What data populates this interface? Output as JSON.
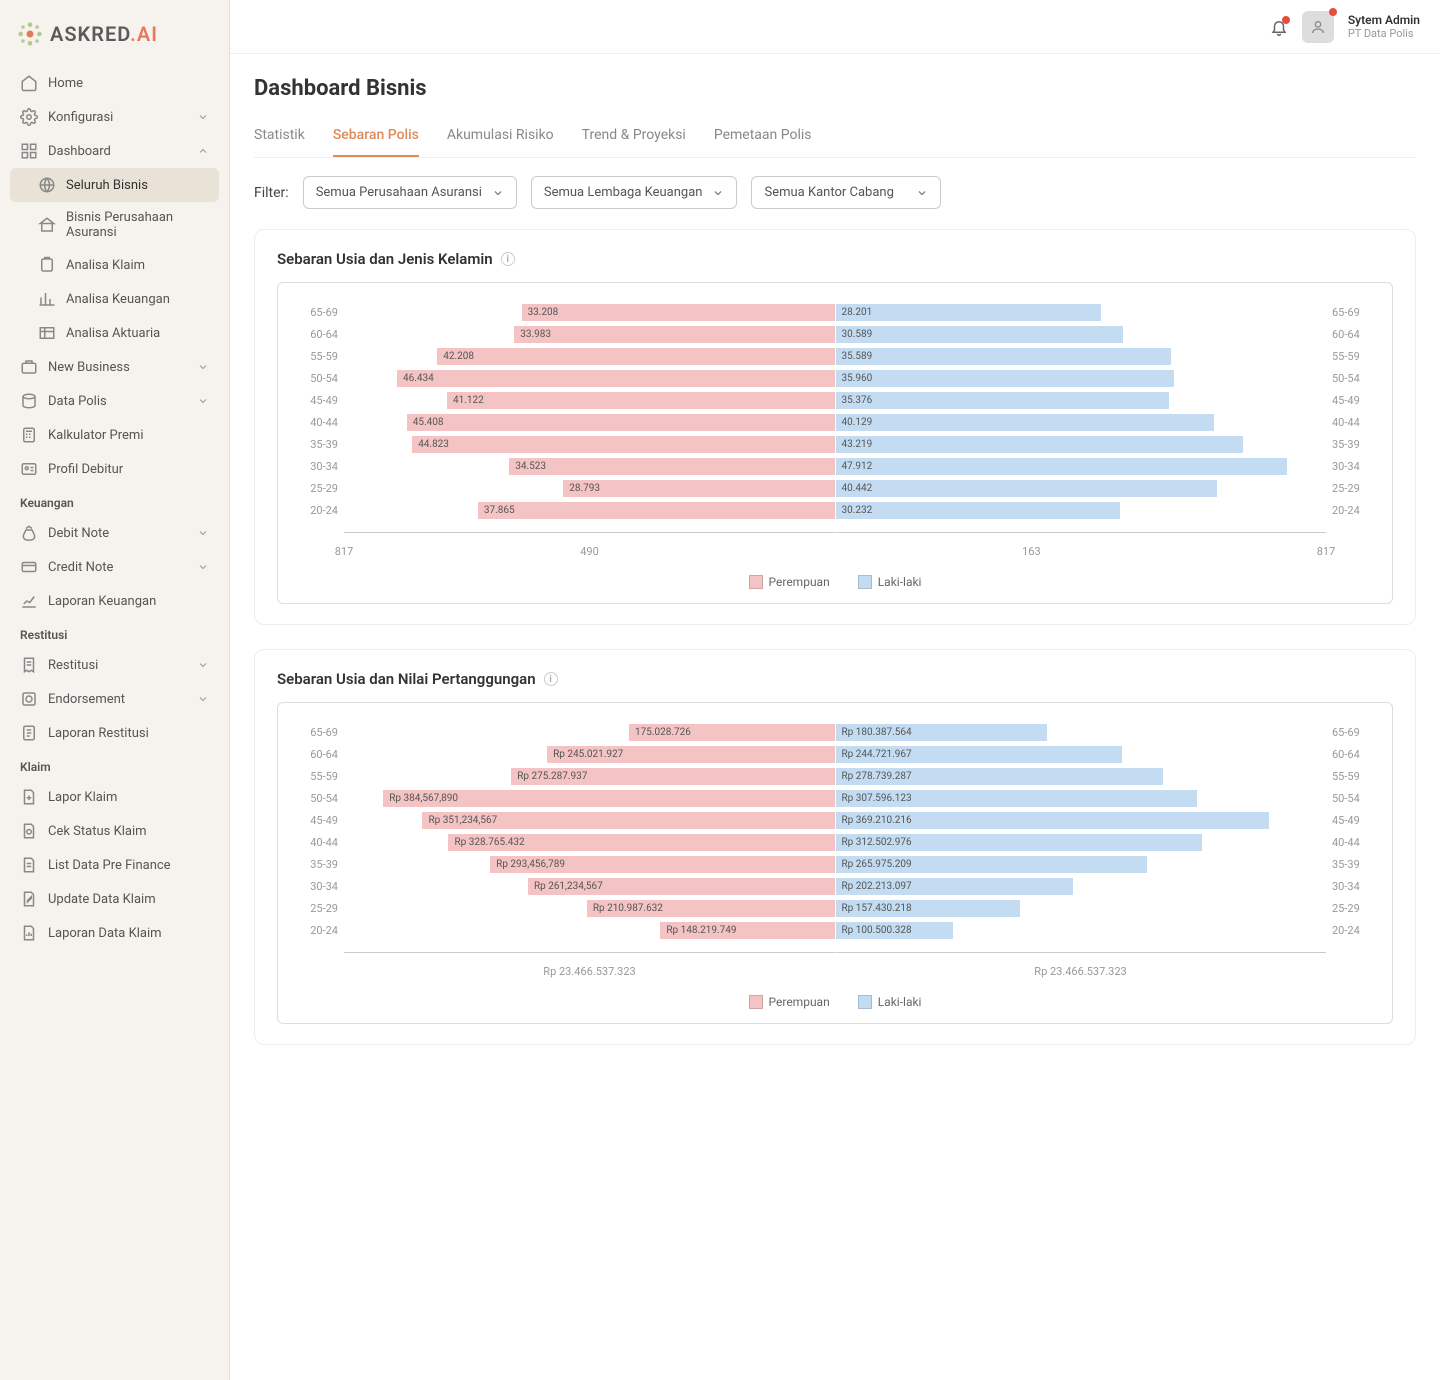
{
  "brand": {
    "text_a": "ASKRED",
    "text_b": ".AI"
  },
  "header": {
    "user_name": "Sytem Admin",
    "user_org": "PT Data Polis"
  },
  "nav": {
    "home": "Home",
    "konfigurasi": "Konfigurasi",
    "dashboard": "Dashboard",
    "seluruh_bisnis": "Seluruh Bisnis",
    "bisnis_perusahaan": "Bisnis Perusahaan Asuransi",
    "analisa_klaim": "Analisa Klaim",
    "analisa_keuangan": "Analisa Keuangan",
    "analisa_aktuaria": "Analisa Aktuaria",
    "new_business": "New Business",
    "data_polis": "Data Polis",
    "kalkulator_premi": "Kalkulator Premi",
    "profil_debitur": "Profil Debitur",
    "section_keuangan": "Keuangan",
    "debit_note": "Debit Note",
    "credit_note": "Credit Note",
    "laporan_keuangan": "Laporan Keuangan",
    "section_restitusi": "Restitusi",
    "restitusi": "Restitusi",
    "endorsement": "Endorsement",
    "laporan_restitusi": "Laporan Restitusi",
    "section_klaim": "Klaim",
    "lapor_klaim": "Lapor Klaim",
    "cek_status_klaim": "Cek Status Klaim",
    "list_data_pre_finance": "List Data Pre Finance",
    "update_data_klaim": "Update Data Klaim",
    "laporan_data_klaim": "Laporan Data Klaim"
  },
  "page": {
    "title": "Dashboard Bisnis",
    "tabs": [
      "Statistik",
      "Sebaran Polis",
      "Akumulasi Risiko",
      "Trend & Proyeksi",
      "Pemetaan Polis"
    ],
    "filter_label": "Filter:",
    "filters": [
      "Semua Perusahaan Asuransi",
      "Semua Lembaga Keuangan",
      "Semua Kantor Cabang"
    ]
  },
  "chart1": {
    "title": "Sebaran Usia dan Jenis Kelamin",
    "legend_fem": "Perempuan",
    "legend_male": "Laki-laki",
    "axis_left": [
      "817",
      "490"
    ],
    "axis_right": [
      "163",
      "817"
    ],
    "rows": [
      {
        "age": "65-69",
        "fem": "33.208",
        "male": "28.201"
      },
      {
        "age": "60-64",
        "fem": "33.983",
        "male": "30.589"
      },
      {
        "age": "55-59",
        "fem": "42.208",
        "male": "35.589"
      },
      {
        "age": "50-54",
        "fem": "46.434",
        "male": "35.960"
      },
      {
        "age": "45-49",
        "fem": "41.122",
        "male": "35.376"
      },
      {
        "age": "40-44",
        "fem": "45.408",
        "male": "40.129"
      },
      {
        "age": "35-39",
        "fem": "44.823",
        "male": "43.219"
      },
      {
        "age": "30-34",
        "fem": "34.523",
        "male": "47.912"
      },
      {
        "age": "25-29",
        "fem": "28.793",
        "male": "40.442"
      },
      {
        "age": "20-24",
        "fem": "37.865",
        "male": "30.232"
      }
    ]
  },
  "chart2": {
    "title": "Sebaran Usia dan Nilai Pertanggungan",
    "legend_fem": "Perempuan",
    "legend_male": "Laki-laki",
    "axis_left": "Rp 23.466.537.323",
    "axis_right": "Rp 23.466.537.323",
    "rows": [
      {
        "age": "65-69",
        "fem": "175.028.726",
        "male": "Rp 180.387.564"
      },
      {
        "age": "60-64",
        "fem": "Rp 245.021.927",
        "male": "Rp 244.721.967"
      },
      {
        "age": "55-59",
        "fem": "Rp 275.287.937",
        "male": "Rp 278.739.287"
      },
      {
        "age": "50-54",
        "fem": "Rp 384,567,890",
        "male": "Rp 307.596.123"
      },
      {
        "age": "45-49",
        "fem": "Rp 351,234,567",
        "male": "Rp 369.210.216"
      },
      {
        "age": "40-44",
        "fem": "Rp 328.765.432",
        "male": "Rp 312.502.976"
      },
      {
        "age": "35-39",
        "fem": "Rp 293,456,789",
        "male": "Rp 265.975.209"
      },
      {
        "age": "30-34",
        "fem": "Rp 261,234,567",
        "male": "Rp 202.213.097"
      },
      {
        "age": "25-29",
        "fem": "Rp 210.987.632",
        "male": "Rp 157.430.218"
      },
      {
        "age": "20-24",
        "fem": "Rp 148.219.749",
        "male": "Rp 100.500.328"
      }
    ]
  },
  "chart_data": [
    {
      "type": "bar",
      "title": "Sebaran Usia dan Jenis Kelamin",
      "orientation": "population-pyramid",
      "categories": [
        "65-69",
        "60-64",
        "55-59",
        "50-54",
        "45-49",
        "40-44",
        "35-39",
        "30-34",
        "25-29",
        "20-24"
      ],
      "series": [
        {
          "name": "Perempuan",
          "values": [
            33208,
            33983,
            42208,
            46434,
            41122,
            45408,
            44823,
            34523,
            28793,
            37865
          ]
        },
        {
          "name": "Laki-laki",
          "values": [
            28201,
            30589,
            35589,
            35960,
            35376,
            40129,
            43219,
            47912,
            40442,
            30232
          ]
        }
      ],
      "xlabel": "",
      "ylabel": "",
      "x_ticks_left": [
        817,
        490
      ],
      "x_ticks_right": [
        163,
        817
      ]
    },
    {
      "type": "bar",
      "title": "Sebaran Usia dan Nilai Pertanggungan",
      "orientation": "population-pyramid",
      "categories": [
        "65-69",
        "60-64",
        "55-59",
        "50-54",
        "45-49",
        "40-44",
        "35-39",
        "30-34",
        "25-29",
        "20-24"
      ],
      "series": [
        {
          "name": "Perempuan",
          "values": [
            175028726,
            245021927,
            275287937,
            384567890,
            351234567,
            328765432,
            293456789,
            261234567,
            210987632,
            148219749
          ]
        },
        {
          "name": "Laki-laki",
          "values": [
            180387564,
            244721967,
            278739287,
            307596123,
            369210216,
            312502976,
            265975209,
            202213097,
            157430218,
            100500328
          ]
        }
      ],
      "xlabel": "Rp",
      "ylabel": "",
      "x_total_left": 23466537323,
      "x_total_right": 23466537323
    }
  ]
}
